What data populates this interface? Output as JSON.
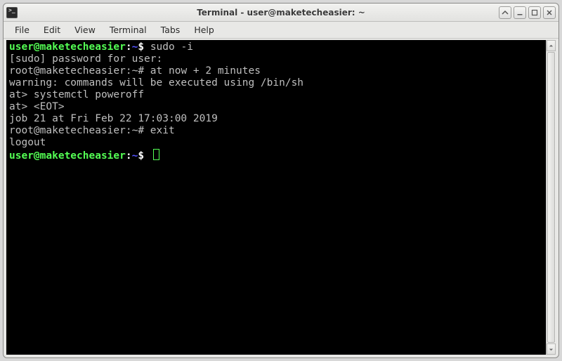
{
  "window": {
    "title": "Terminal - user@maketecheasier: ~"
  },
  "menu": {
    "file": "File",
    "edit": "Edit",
    "view": "View",
    "terminal": "Terminal",
    "tabs": "Tabs",
    "help": "Help"
  },
  "terminal": {
    "lines": [
      {
        "user": "user@maketecheasier",
        "path": "~",
        "sep": ":",
        "prompt": "$",
        "cmd": "sudo -i",
        "style": "user"
      },
      {
        "plain": "[sudo] password for user:"
      },
      {
        "user": "root@maketecheasier",
        "path": "~",
        "sep": ":",
        "prompt": "#",
        "cmd": "at now + 2 minutes",
        "style": "root"
      },
      {
        "plain": "warning: commands will be executed using /bin/sh"
      },
      {
        "plain": "at> systemctl poweroff"
      },
      {
        "plain": "at> <EOT>"
      },
      {
        "plain": "job 21 at Fri Feb 22 17:03:00 2019"
      },
      {
        "user": "root@maketecheasier",
        "path": "~",
        "sep": ":",
        "prompt": "#",
        "cmd": "exit",
        "style": "root"
      },
      {
        "plain": "logout"
      },
      {
        "user": "user@maketecheasier",
        "path": "~",
        "sep": ":",
        "prompt": "$",
        "cmd": "",
        "style": "user",
        "cursor": true
      }
    ]
  }
}
